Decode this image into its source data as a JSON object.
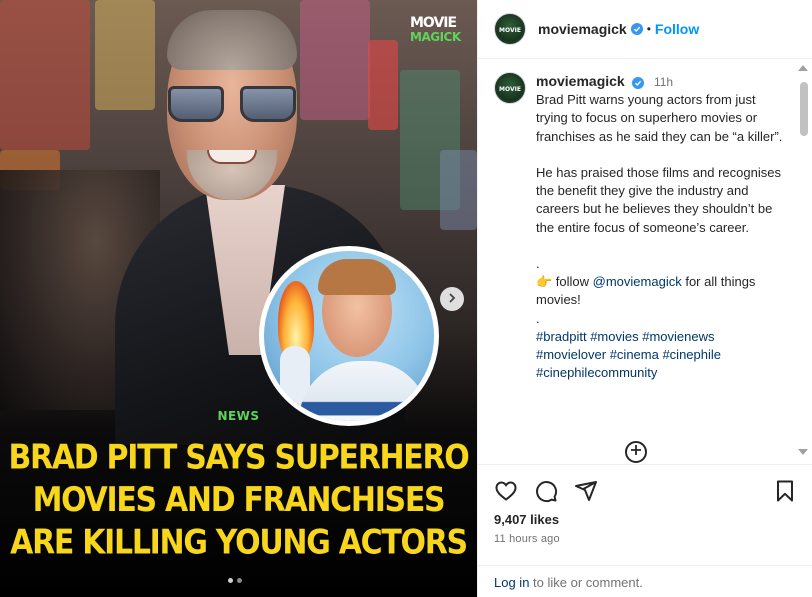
{
  "post": {
    "logo_top": "MOVIE",
    "logo_bottom": "MAGICK",
    "news_tag": "NEWS",
    "headline": "BRAD PITT SAYS SUPERHERO MOVIES AND FRANCHISES ARE KILLING YOUNG ACTORS",
    "carousel_total": 2,
    "carousel_active": 1
  },
  "header": {
    "username": "moviemagick",
    "separator": "•",
    "follow_label": "Follow",
    "avatar_text": "MOVIE"
  },
  "caption": {
    "username": "moviemagick",
    "time": "11h",
    "p1": "Brad Pitt warns young actors from just trying to focus on superhero movies or franchises as he said they can be “a killer”.",
    "p2": "He has praised those films and recognises the benefit they give the industry and careers but he believes they shouldn’t be the entire focus of someone’s career.",
    "dot1": ".",
    "follow_pre": "👉 follow ",
    "follow_mention": "@moviemagick",
    "follow_post": " for all things movies!",
    "dot2": ".",
    "hashtags": "#bradpitt #movies #movienews #movielover #cinema #cinephile #cinephilecommunity"
  },
  "actions": {
    "likes": "9,407 likes",
    "time_ago": "11 hours ago",
    "login_link": "Log in",
    "login_text": " to like or comment."
  },
  "icons": [
    "heart-icon",
    "comment-icon",
    "share-icon",
    "bookmark-icon",
    "add-comment-icon",
    "chevron-right-icon",
    "verified-icon"
  ],
  "colors": {
    "accent": "#0095f6",
    "headline": "#f7d61b",
    "news_tag": "#5fd35a",
    "link": "#00376b",
    "verified": "#3897f0"
  }
}
